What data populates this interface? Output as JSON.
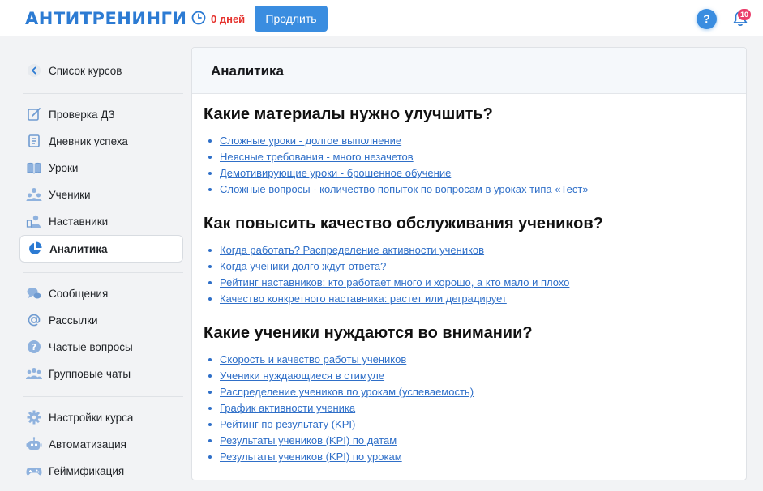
{
  "header": {
    "logo": "АНТИТРЕНИНГИ",
    "days_left": "0 дней",
    "renew_label": "Продлить",
    "help_label": "?",
    "notifications_count": "10",
    "accent_color": "#3a8de0"
  },
  "sidebar": {
    "back_label": "Список курсов",
    "group1": [
      {
        "label": "Проверка ДЗ",
        "icon": "homework-check-icon"
      },
      {
        "label": "Дневник успеха",
        "icon": "diary-icon"
      },
      {
        "label": "Уроки",
        "icon": "lessons-book-icon"
      },
      {
        "label": "Ученики",
        "icon": "students-icon"
      },
      {
        "label": "Наставники",
        "icon": "mentors-icon"
      },
      {
        "label": "Аналитика",
        "icon": "analytics-pie-icon",
        "active": true
      }
    ],
    "group2": [
      {
        "label": "Сообщения",
        "icon": "messages-icon"
      },
      {
        "label": "Рассылки",
        "icon": "mailing-at-icon"
      },
      {
        "label": "Частые вопросы",
        "icon": "faq-icon"
      },
      {
        "label": "Групповые чаты",
        "icon": "group-chat-icon"
      }
    ],
    "group3": [
      {
        "label": "Настройки курса",
        "icon": "gear-icon"
      },
      {
        "label": "Автоматизация",
        "icon": "robot-icon"
      },
      {
        "label": "Геймификация",
        "icon": "gamepad-icon"
      }
    ]
  },
  "main": {
    "title": "Аналитика",
    "sections": [
      {
        "title": "Какие материалы нужно улучшить?",
        "links": [
          "Сложные уроки - долгое выполнение",
          "Неясные требования - много незачетов",
          "Демотивирующие уроки - брошенное обучение",
          "Сложные вопросы - количество попыток по вопросам в уроках типа «Тест»"
        ]
      },
      {
        "title": "Как повысить качество обслуживания учеников?",
        "links": [
          "Когда работать? Распределение активности учеников",
          "Когда ученики долго ждут ответа?",
          "Рейтинг наставников: кто работает много и хорошо, а кто мало и плохо",
          "Качество конкретного наставника: растет или деградирует"
        ]
      },
      {
        "title": "Какие ученики нуждаются во внимании?",
        "links": [
          "Скорость и качество работы учеников",
          "Ученики нуждающиеся в стимуле",
          "Распределение учеников по урокам (успеваемость)",
          "График активности ученика",
          "Рейтинг по результату (KPI)",
          "Результаты учеников (KPI) по датам",
          "Результаты учеников (KPI) по урокам"
        ]
      }
    ]
  }
}
